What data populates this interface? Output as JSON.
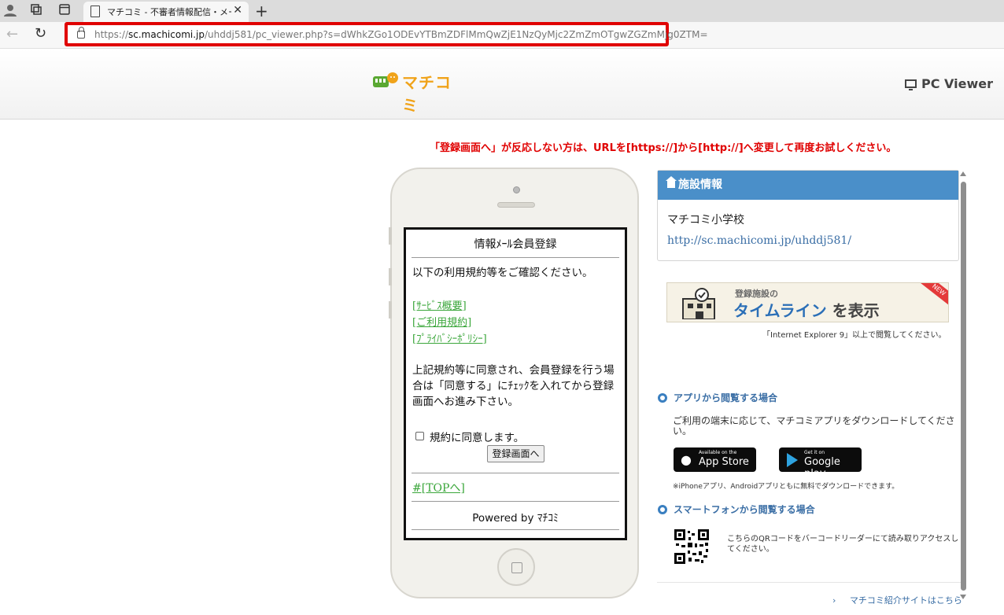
{
  "browser": {
    "tab_title": "マチコミ - 不審者情報配信・メール連",
    "url_prefix": "https://",
    "url_host": "sc.machicomi.jp",
    "url_rest": "/uhddj581/pc_viewer.php?s=dWhkZGo1ODEvYTBmZDFlMmQwZjE1NzQyMjc2ZmZmOTgwZGZmMjg0ZTM="
  },
  "header": {
    "logo_text": "マチコミ",
    "pc_viewer_label": "PC Viewer"
  },
  "notice": "「登録画面へ」が反応しない方は、URLを[https://]から[http://]へ変更して再度お試しください。",
  "phone_screen": {
    "title": "情報ﾒｰﾙ会員登録",
    "intro": "以下の利用規約等をご確認ください。",
    "links": [
      "[ｻｰﾋﾞｽ概要]",
      "[ご利用規約]",
      "[ﾌﾟﾗｲﾊﾞｼｰﾎﾟﾘｼｰ]"
    ],
    "agree_text": "上記規約等に同意され、会員登録を行う場合は「同意する」にﾁｪｯｸを入れてから登録画面へお進み下さい。",
    "checkbox_label": "規約に同意します。",
    "register_button": "登録画面へ",
    "top_link": "#[TOPへ]",
    "powered_by": "Powered by ﾏﾁｺﾐ"
  },
  "facility": {
    "header": "施設情報",
    "school_name": "マチコミ小学校",
    "school_url": "http://sc.machicomi.jp/uhddj581/"
  },
  "timeline_banner": {
    "small_text": "登録施設の",
    "big_text": "タイムライン",
    "suffix": "を表示",
    "badge": "NEW"
  },
  "ie_note": "「Internet Explorer 9」以上で閲覧してください。",
  "app_section": {
    "title": "アプリから閲覧する場合",
    "text": "ご利用の端末に応じて、マチコミアプリをダウンロードしてください。",
    "appstore_small": "Available on the",
    "appstore_big": "App Store",
    "gplay_small": "Get it on",
    "gplay_big": "Google play",
    "note": "※iPhoneアプリ、Androidアプリともに無料でダウンロードできます。"
  },
  "smartphone_section": {
    "title": "スマートフォンから閲覧する場合",
    "text": "こちらのQRコードをバーコードリーダーにて読み取りアクセスしてください。"
  },
  "footer_link": "マチコミ紹介サイトはこちら",
  "colors": {
    "accent_blue": "#4a8fc9",
    "notice_red": "#e00000",
    "link_green": "#3aa63a",
    "logo_orange": "#f0a31a"
  }
}
